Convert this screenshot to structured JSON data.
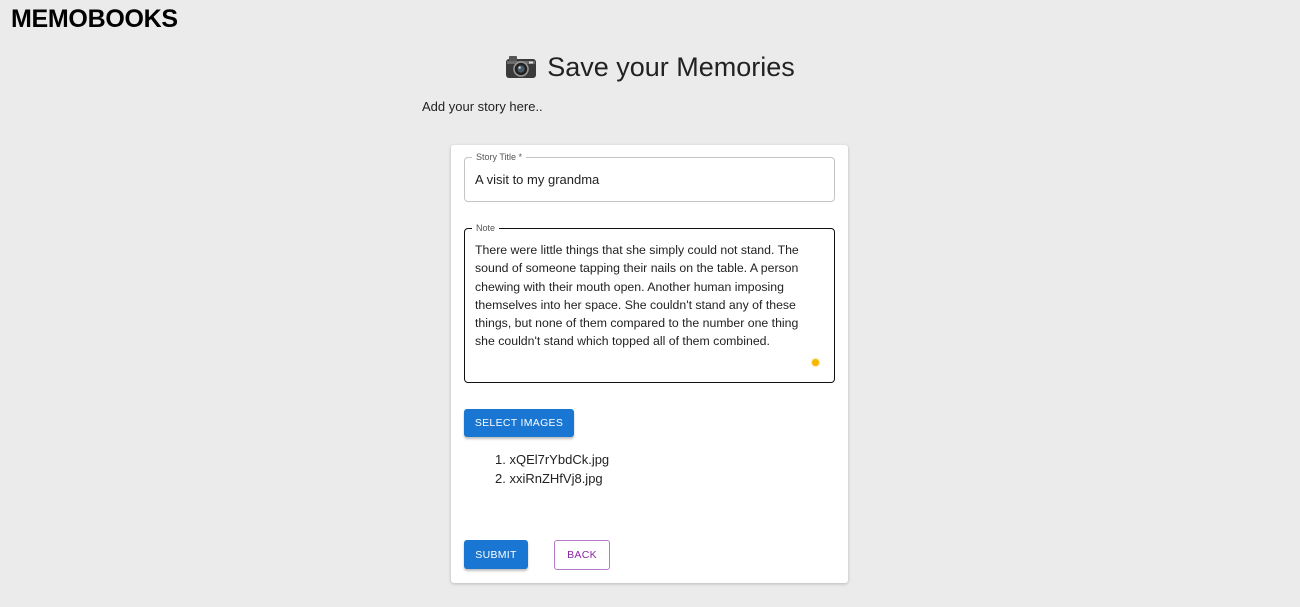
{
  "header": {
    "brand": "MEMOBOOKS"
  },
  "page": {
    "title": "Save your Memories",
    "title_icon": "camera-icon",
    "subtitle": "Add your story here.."
  },
  "form": {
    "title_field": {
      "label": "Story Title *",
      "value": "A visit to my grandma"
    },
    "note_field": {
      "label": "Note",
      "value": "There were little things that she simply could not stand. The sound of someone tapping their nails on the table. A person chewing with their mouth open. Another human imposing themselves into her space. She couldn't stand any of these things, but none of them compared to the number one thing she couldn't stand which topped all of them combined."
    },
    "select_images_label": "Select Images",
    "files": [
      "1. xQEl7rYbdCk.jpg",
      "2. xxiRnZHfVj8.jpg"
    ],
    "submit_label": "Submit",
    "back_label": "Back"
  },
  "colors": {
    "primary": "#1976d2",
    "secondary": "#8e24aa",
    "background": "#ebebeb"
  }
}
